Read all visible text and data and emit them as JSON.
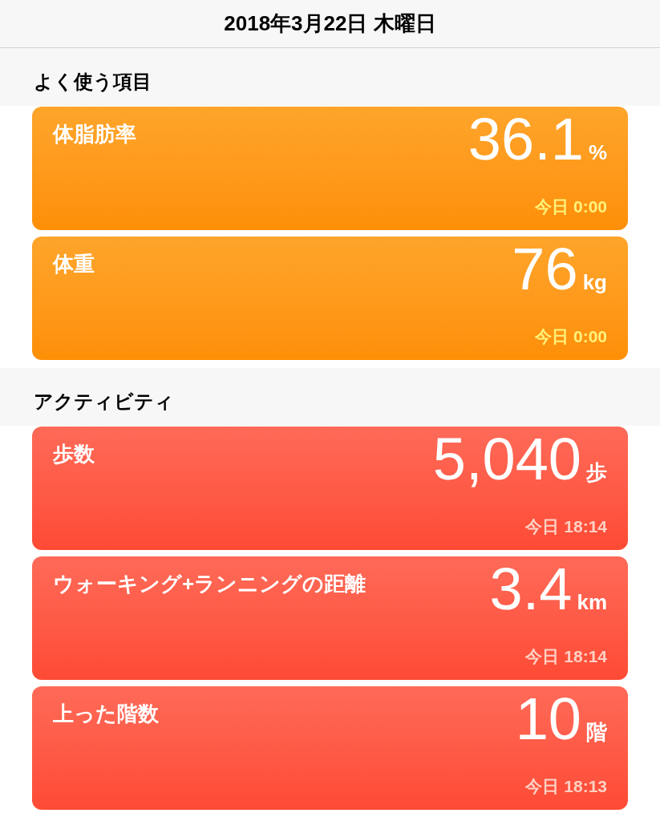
{
  "header": {
    "title": "2018年3月22日 木曜日"
  },
  "sections": [
    {
      "title": "よく使う項目",
      "kind": "favorites",
      "cards": [
        {
          "label": "体脂肪率",
          "value": "36.1",
          "unit": "%",
          "time": "今日 0:00"
        },
        {
          "label": "体重",
          "value": "76",
          "unit": "kg",
          "time": "今日 0:00"
        }
      ]
    },
    {
      "title": "アクティビティ",
      "kind": "activity",
      "cards": [
        {
          "label": "歩数",
          "value": "5,040",
          "unit": "歩",
          "time": "今日 18:14"
        },
        {
          "label": "ウォーキング+ランニングの距離",
          "value": "3.4",
          "unit": "km",
          "time": "今日 18:14"
        },
        {
          "label": "上った階数",
          "value": "10",
          "unit": "階",
          "time": "今日 18:13"
        }
      ]
    }
  ]
}
